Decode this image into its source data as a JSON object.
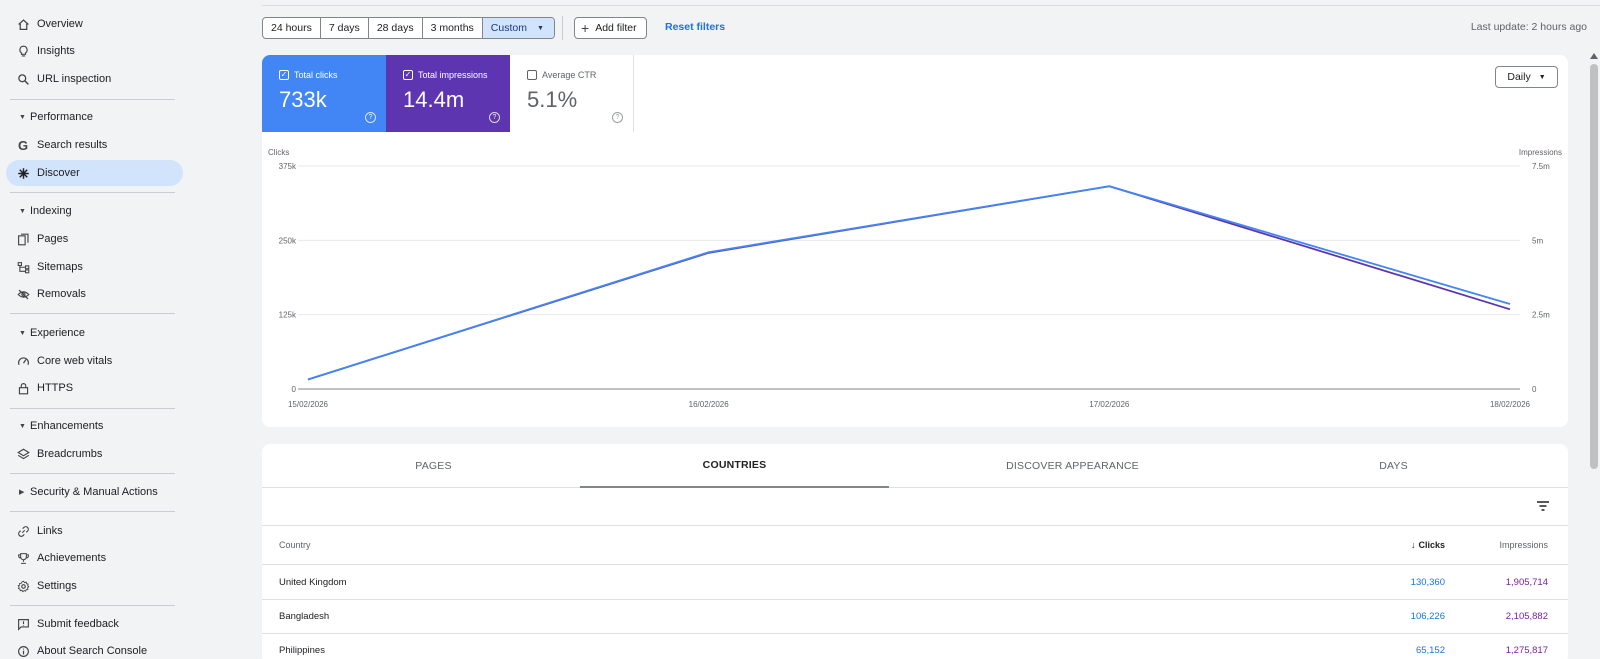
{
  "sidebar": {
    "items": [
      {
        "label": "Overview",
        "icon": "home-icon"
      },
      {
        "label": "Insights",
        "icon": "lightbulb-icon"
      },
      {
        "label": "URL inspection",
        "icon": "search-icon"
      },
      {
        "label": "Search results",
        "icon": "google-g-icon"
      },
      {
        "label": "Discover",
        "icon": "asterisk-icon",
        "active": true
      },
      {
        "label": "Pages",
        "icon": "pages-icon"
      },
      {
        "label": "Sitemaps",
        "icon": "sitemap-icon"
      },
      {
        "label": "Removals",
        "icon": "eye-off-icon"
      },
      {
        "label": "Core web vitals",
        "icon": "gauge-icon"
      },
      {
        "label": "HTTPS",
        "icon": "lock-icon"
      },
      {
        "label": "Breadcrumbs",
        "icon": "layers-icon"
      },
      {
        "label": "Links",
        "icon": "link-icon"
      },
      {
        "label": "Achievements",
        "icon": "trophy-icon"
      },
      {
        "label": "Settings",
        "icon": "gear-icon"
      },
      {
        "label": "Submit feedback",
        "icon": "feedback-icon"
      },
      {
        "label": "About Search Console",
        "icon": "info-icon"
      }
    ],
    "sections": {
      "performance": "Performance",
      "indexing": "Indexing",
      "experience": "Experience",
      "enhancements": "Enhancements",
      "security": "Security & Manual Actions"
    }
  },
  "toolbar": {
    "ranges": [
      "24 hours",
      "7 days",
      "28 days",
      "3 months"
    ],
    "custom_label": "Custom",
    "add_filter": "Add filter",
    "reset_filters": "Reset filters",
    "last_update": "Last update: 2 hours ago"
  },
  "metrics": {
    "clicks": {
      "label": "Total clicks",
      "value": "733k",
      "checked": true
    },
    "impressions": {
      "label": "Total impressions",
      "value": "14.4m",
      "checked": true
    },
    "ctr": {
      "label": "Average CTR",
      "value": "5.1%",
      "checked": false
    }
  },
  "granularity": "Daily",
  "colors": {
    "clicks": "#4285f4",
    "impressions": "#5e35b1",
    "active_nav": "#d2e3fc",
    "link": "#1a73e8"
  },
  "chart_data": {
    "type": "line",
    "x": [
      "15/02/2026",
      "16/02/2026",
      "17/02/2026",
      "18/02/2026"
    ],
    "left_axis": {
      "label": "Clicks",
      "ticks": [
        "0",
        "125k",
        "250k",
        "375k"
      ],
      "tick_values": [
        0,
        125000,
        250000,
        375000
      ],
      "ylim": [
        0,
        375000
      ]
    },
    "right_axis": {
      "label": "Impressions",
      "ticks": [
        "0",
        "2.5m",
        "5m",
        "7.5m"
      ],
      "tick_values": [
        0,
        2500000,
        5000000,
        7500000
      ],
      "ylim": [
        0,
        7500000
      ]
    },
    "series": [
      {
        "name": "Clicks",
        "axis": "left",
        "color": "#4285f4",
        "values": [
          16000,
          230000,
          341000,
          143000
        ]
      },
      {
        "name": "Impressions",
        "axis": "right",
        "color": "#5e35b1",
        "values": [
          320000,
          4580000,
          6820000,
          2680000
        ]
      }
    ],
    "grid": true
  },
  "table": {
    "tabs": [
      "PAGES",
      "COUNTRIES",
      "DISCOVER APPEARANCE",
      "DAYS"
    ],
    "active_tab": "COUNTRIES",
    "columns": {
      "country": "Country",
      "clicks": "Clicks",
      "impressions": "Impressions"
    },
    "rows": [
      {
        "country": "United Kingdom",
        "clicks": "130,360",
        "impressions": "1,905,714"
      },
      {
        "country": "Bangladesh",
        "clicks": "106,226",
        "impressions": "2,105,882"
      },
      {
        "country": "Philippines",
        "clicks": "65,152",
        "impressions": "1,275,817"
      }
    ]
  }
}
